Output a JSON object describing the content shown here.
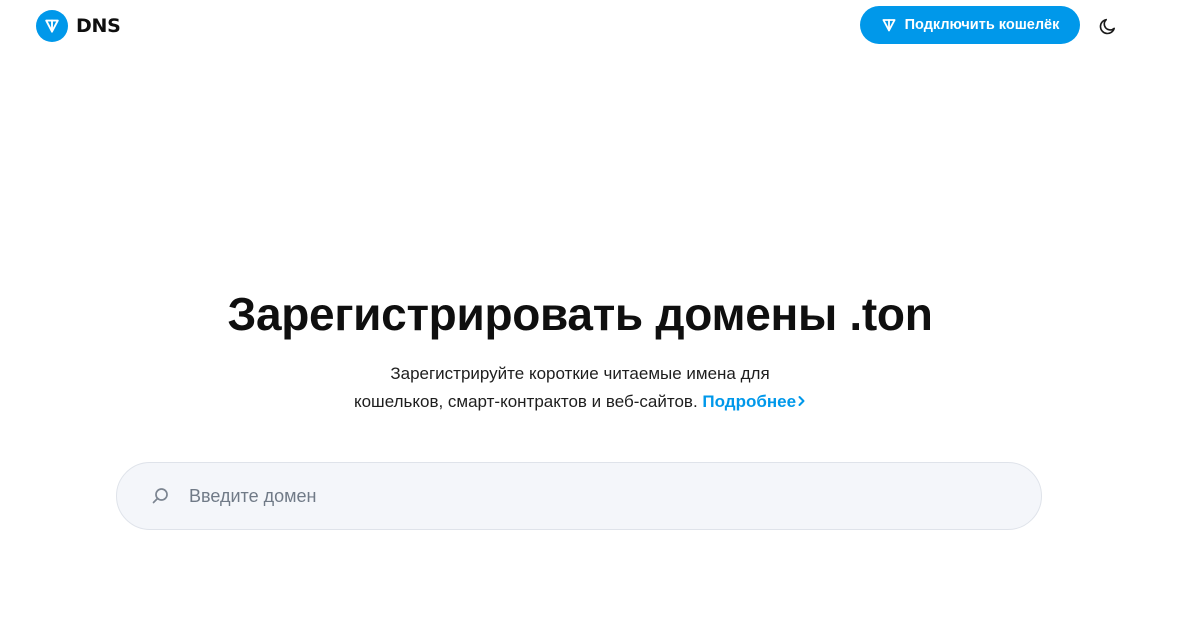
{
  "header": {
    "logo_text": "DNS",
    "connect_label": "Подключить кошелёк",
    "theme_toggle_icon": "moon-icon"
  },
  "hero": {
    "title": "Зарегистрировать домены .ton",
    "subtitle_line1": "Зарегистрируйте короткие читаемые имена для",
    "subtitle_line2": "кошельков, смарт-контрактов и веб-сайтов.",
    "more_link": "Подробнее"
  },
  "search": {
    "placeholder": "Введите домен",
    "value": ""
  },
  "colors": {
    "accent": "#0098ea",
    "text": "#0f0f0f",
    "search_bg": "#f4f6fa",
    "placeholder": "#707a87"
  }
}
